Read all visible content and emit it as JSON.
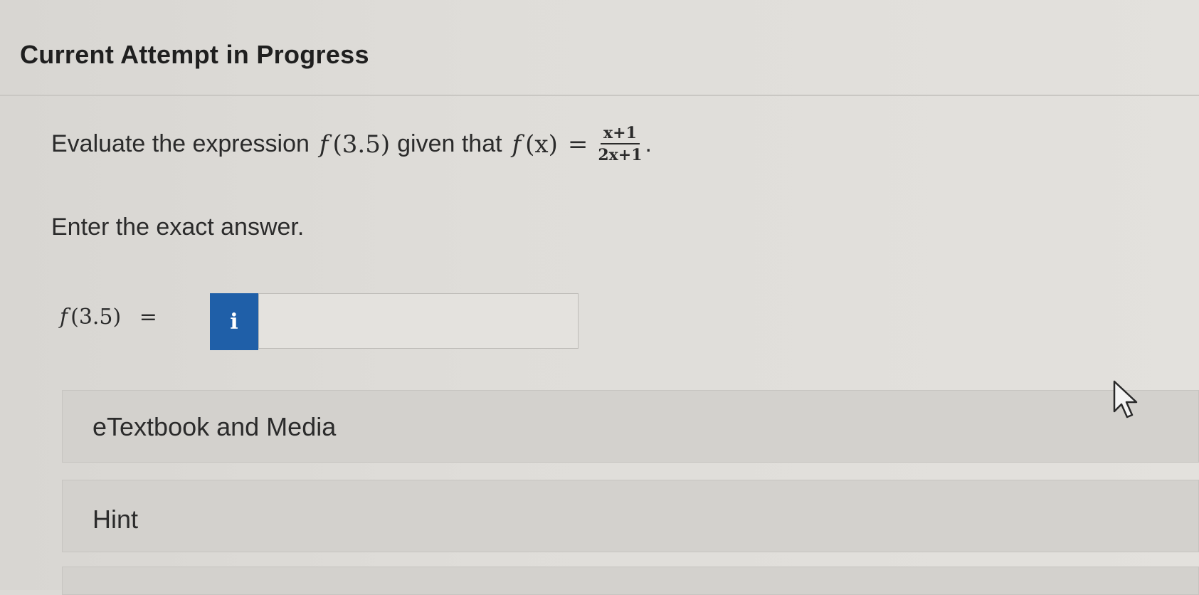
{
  "header": {
    "title": "Current Attempt in Progress"
  },
  "question": {
    "prefix": "Evaluate the expression",
    "f1": "f",
    "arg1": "(3.5)",
    "middle": "given that",
    "f2": "f",
    "arg2": "(x)",
    "equals": "=",
    "numerator": "x+1",
    "denominator": "2x+1",
    "period": "."
  },
  "instruction": "Enter the exact answer.",
  "answer": {
    "f": "f",
    "arg": "(3.5)",
    "equals": "=",
    "info_glyph": "i",
    "value": ""
  },
  "panels": {
    "media_label": "eTextbook and Media",
    "hint_label": "Hint"
  },
  "icons": {
    "info": "info-icon",
    "cursor": "mouse-pointer-icon"
  },
  "colors": {
    "accent": "#1f5fa8"
  }
}
